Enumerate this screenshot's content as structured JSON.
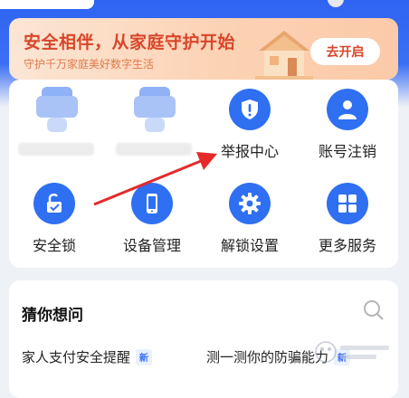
{
  "banner": {
    "title": "安全相伴，从家庭守护开始",
    "subtitle": "守护千万家庭美好数字生活",
    "button_label": "去开启"
  },
  "services": [
    {
      "label": "",
      "icon": "blurred-icon",
      "blurred": true
    },
    {
      "label": "",
      "icon": "blurred-icon",
      "blurred": true
    },
    {
      "label": "举报中心",
      "icon": "shield-alert-icon"
    },
    {
      "label": "账号注销",
      "icon": "person-icon"
    },
    {
      "label": "安全锁",
      "icon": "lock-icon"
    },
    {
      "label": "设备管理",
      "icon": "phone-icon"
    },
    {
      "label": "解锁设置",
      "icon": "gear-icon"
    },
    {
      "label": "更多服务",
      "icon": "grid-icon"
    }
  ],
  "guess": {
    "title": "猜你想问",
    "items": [
      {
        "text": "家人支付安全提醒",
        "badge": "新"
      },
      {
        "text": "测一测你的防骗能力",
        "badge": "新"
      }
    ]
  },
  "colors": {
    "brand_blue": "#2f6ff2",
    "banner_red": "#d8462a",
    "arrow_red": "#e52a2a"
  }
}
